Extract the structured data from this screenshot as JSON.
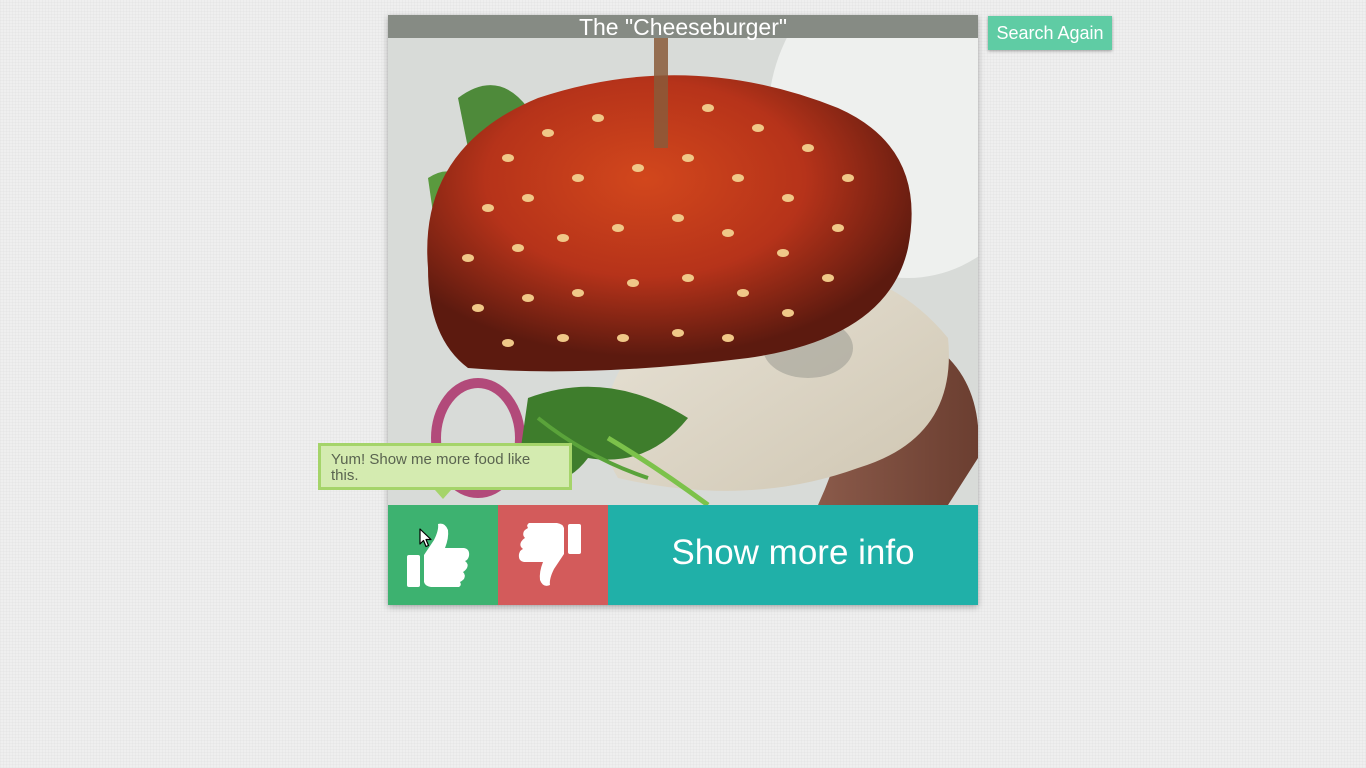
{
  "card": {
    "title": "The \"Cheeseburger\"",
    "photo_subject": "burger-photo"
  },
  "actions": {
    "like_icon": "thumbs-up-icon",
    "dislike_icon": "thumbs-down-icon",
    "info_label": "Show more info"
  },
  "search_again_label": "Search Again",
  "tooltip": {
    "text": "Yum! Show me more food like this."
  },
  "colors": {
    "title_bar": "#868b84",
    "like": "#3db270",
    "dislike": "#d35b5b",
    "info": "#20b0a8",
    "search_again": "#5fcca4",
    "tooltip_bg": "#d4ebb0",
    "tooltip_border": "#a5d46a"
  }
}
